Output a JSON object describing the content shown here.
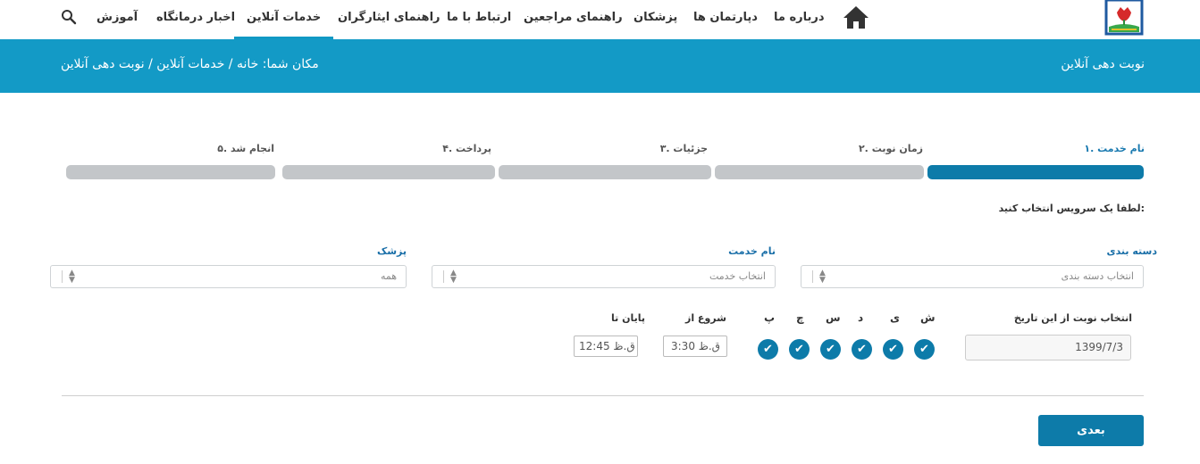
{
  "nav": {
    "items": [
      {
        "label": "درباره ما"
      },
      {
        "label": "دپارتمان ها"
      },
      {
        "label": "پزشکان"
      },
      {
        "label": "راهنمای مراجعین"
      },
      {
        "label": "ارتباط با ما"
      },
      {
        "label": "راهنمای ایثارگران"
      },
      {
        "label": "خدمات آنلاین"
      },
      {
        "label": "اخبار درمانگاه"
      },
      {
        "label": "آموزش"
      }
    ],
    "active": "خدمات آنلاین"
  },
  "header": {
    "title": "نوبت دهی آنلاین",
    "breadcrumb": "مکان شما: خانه / خدمات آنلاین / نوبت دهی آنلاین"
  },
  "steps": [
    {
      "label": "۱. نام خدمت",
      "active": true
    },
    {
      "label": "۲. زمان نوبت",
      "active": false
    },
    {
      "label": "۳. جزئیات",
      "active": false
    },
    {
      "label": "۴. پرداخت",
      "active": false
    },
    {
      "label": "۵. انجام شد",
      "active": false
    }
  ],
  "form": {
    "prompt": "لطفا یک سرویس انتخاب کنید:",
    "category_label": "دسته بندی",
    "category_placeholder": "انتخاب دسته بندی",
    "service_label": "نام خدمت",
    "service_placeholder": "انتخاب خدمت",
    "doctor_label": "پزشک",
    "doctor_value": "همه",
    "date_label": "انتخاب نوبت از این تاریخ",
    "date_value": "1399/7/3",
    "days": [
      "ش",
      "ی",
      "د",
      "س",
      "چ",
      "پ"
    ],
    "start_label": "شروع از",
    "start_value": "3:30 ق.ظ",
    "end_label": "پایان تا",
    "end_value": "12:45 ق.ظ"
  },
  "next_button": "بعدی",
  "colors": {
    "accent": "#139ac6",
    "primary": "#0d7ba9",
    "inactive_step": "#c3c6c9"
  }
}
